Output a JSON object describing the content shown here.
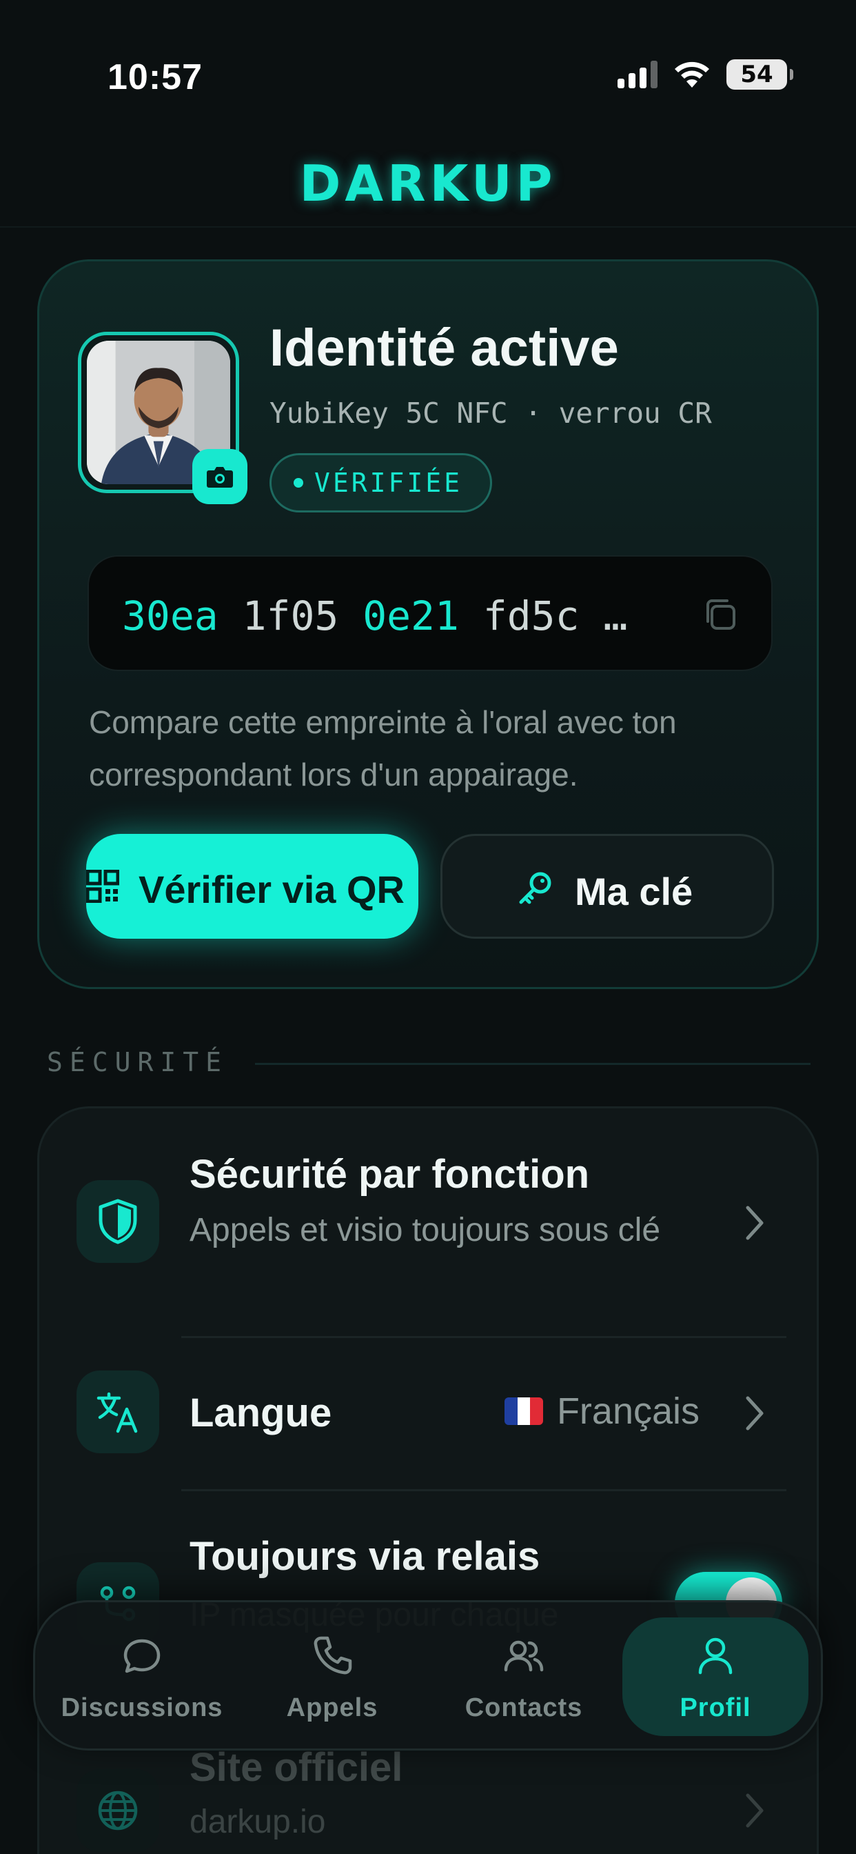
{
  "status": {
    "time": "10:57",
    "battery": "54"
  },
  "app": {
    "logo": "DARKUP"
  },
  "identity": {
    "title": "Identité active",
    "subtitle": "YubiKey 5C NFC · verrou CR",
    "badge": "VÉRIFIÉE",
    "fingerprint": [
      "30ea",
      "1f05",
      "0e21",
      "fd5c",
      "…"
    ],
    "help": "Compare cette empreinte à l'oral avec ton correspondant lors d'un appairage.",
    "verify_qr_label": "Vérifier via QR",
    "my_key_label": "Ma clé"
  },
  "section": {
    "label": "SÉCURITÉ"
  },
  "settings": {
    "items": [
      {
        "title": "Sécurité par fonction",
        "subtitle": "Appels et visio toujours sous clé",
        "icon": "shield-icon"
      },
      {
        "title": "Langue",
        "value": "Français",
        "icon": "translate-icon"
      },
      {
        "title": "Toujours via relais",
        "subtitle": "IP masquée pour chaque",
        "icon": "relay-icon",
        "toggle_on": true
      },
      {
        "title": "Site officiel",
        "subtitle": "darkup.io",
        "icon": "globe-icon"
      }
    ]
  },
  "tabs": [
    {
      "label": "Discussions",
      "icon": "chat-icon"
    },
    {
      "label": "Appels",
      "icon": "phone-icon"
    },
    {
      "label": "Contacts",
      "icon": "contacts-icon"
    },
    {
      "label": "Profil",
      "icon": "profile-icon",
      "active": true
    }
  ],
  "colors": {
    "accent": "#18e8cf",
    "background": "#0b1011"
  }
}
